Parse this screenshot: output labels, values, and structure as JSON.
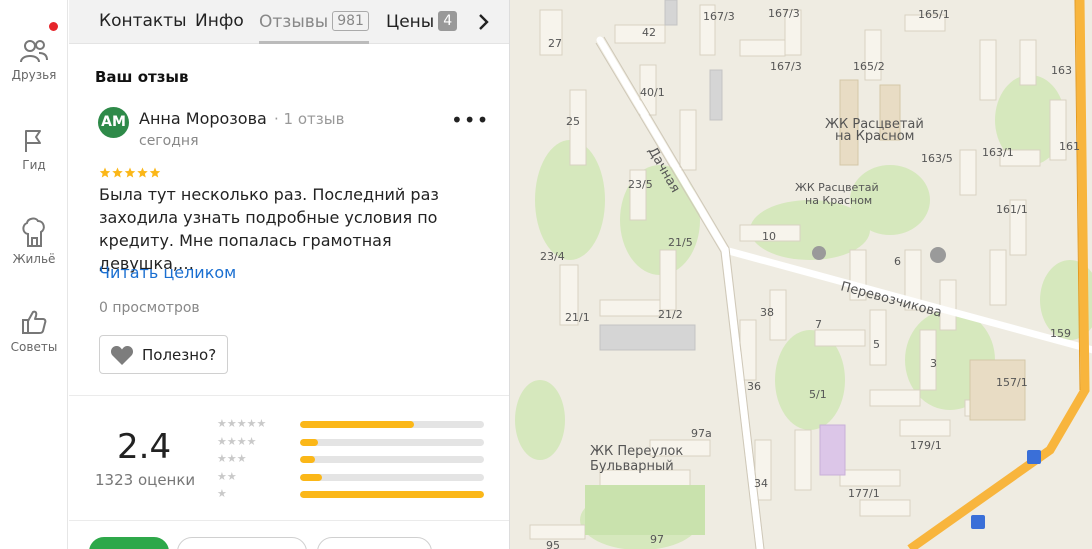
{
  "rail": {
    "items": [
      {
        "label": "Друзья",
        "icon": "friends-icon"
      },
      {
        "label": "Гид",
        "icon": "flag-icon"
      },
      {
        "label": "Жильё",
        "icon": "house-icon"
      },
      {
        "label": "Советы",
        "icon": "thumbs-up-icon"
      }
    ],
    "notification_color": "#e6252b"
  },
  "tabs": {
    "items": [
      {
        "label": "Контакты"
      },
      {
        "label": "Инфо"
      },
      {
        "label": "Отзывы",
        "count": "981",
        "active": true
      },
      {
        "label": "Цены",
        "count": "4"
      }
    ],
    "next_icon": "chevron-right-icon"
  },
  "review": {
    "section_title": "Ваш отзыв",
    "avatar_initials": "АМ",
    "avatar_color": "#2e8a49",
    "author": "Анна Морозова",
    "author_meta": "· 1 отзыв",
    "date": "сегодня",
    "rating": 5,
    "text": "Была тут несколько раз. Последний раз заходила узнать подробные условия по кредиту. Мне попалась грамотная девушка,…",
    "read_more": "Читать целиком",
    "views": "0 просмотров",
    "useful_label": "Полезно?"
  },
  "summary": {
    "rating": "2.4",
    "count_label": "1323 оценки",
    "distribution": [
      {
        "stars": 5,
        "fraction": 0.62
      },
      {
        "stars": 4,
        "fraction": 0.1
      },
      {
        "stars": 3,
        "fraction": 0.08
      },
      {
        "stars": 2,
        "fraction": 0.12
      },
      {
        "stars": 1,
        "fraction": 1.0
      }
    ],
    "bar_color": "#fbb718"
  },
  "map": {
    "street_labels": [
      "Дачная",
      "Перевозчикова"
    ],
    "place_labels": [
      "ЖК Расцветай на Красном",
      "ЖК Расцветай на Красном",
      "ЖК Переулок Бульварный"
    ],
    "house_numbers": [
      "27",
      "42",
      "167/3",
      "167/3",
      "167/3",
      "165/1",
      "163",
      "40/1",
      "165/2",
      "25",
      "163/5",
      "163/1",
      "161",
      "23/5",
      "161/1",
      "10",
      "21/5",
      "23/4",
      "6",
      "38",
      "7",
      "21/1",
      "21/2",
      "5",
      "159",
      "3",
      "157/1",
      "36",
      "5/1",
      "179/1",
      "97а",
      "34",
      "177/1",
      "97",
      "95"
    ]
  }
}
